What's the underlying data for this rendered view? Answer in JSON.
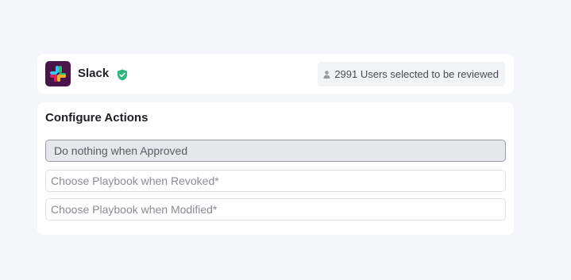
{
  "app": {
    "name": "Slack",
    "users_badge": "2991 Users selected to be reviewed"
  },
  "configure": {
    "title": "Configure Actions",
    "approved_value": "Do nothing when Approved",
    "revoked_placeholder": "Choose Playbook when Revoked*",
    "modified_placeholder": "Choose Playbook when Modified*"
  },
  "colors": {
    "slack_bg": "#4a154b",
    "verified_green": "#2eb67d"
  }
}
